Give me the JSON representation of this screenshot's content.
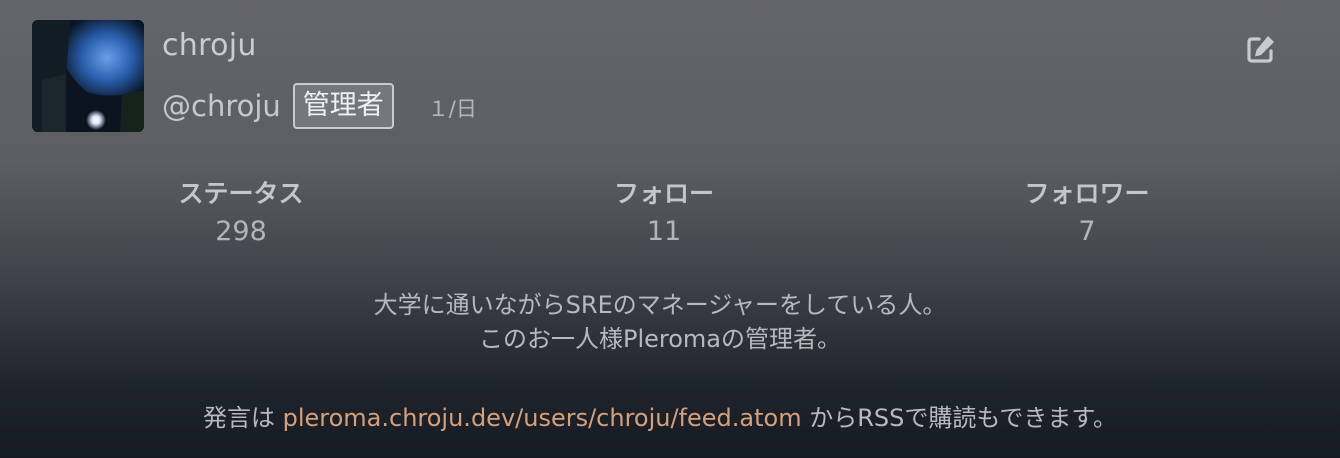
{
  "profile": {
    "display_name": "chroju",
    "handle": "@chroju",
    "role_badge": "管理者",
    "post_rate": "１/日"
  },
  "stats": [
    {
      "label": "ステータス",
      "value": "298"
    },
    {
      "label": "フォロー",
      "value": "11"
    },
    {
      "label": "フォロワー",
      "value": "7"
    }
  ],
  "bio": {
    "line1": "大学に通いながらSREのマネージャーをしている人。",
    "line2": "このお一人様Pleromaの管理者。"
  },
  "feed": {
    "prefix": "発言は",
    "link": "pleroma.chroju.dev/users/chroju/feed.atom",
    "suffix": "からRSSで購読もできます。"
  },
  "icons": {
    "edit": "edit-icon"
  },
  "colors": {
    "link": "#d6a07a",
    "badge_bg": "#75777c"
  }
}
